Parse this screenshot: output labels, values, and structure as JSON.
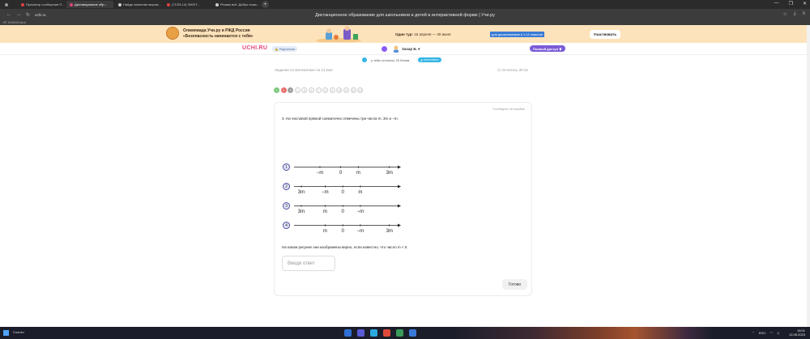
{
  "browser": {
    "tabs": [
      {
        "label": "",
        "color": "#9a9a9a"
      },
      {
        "label": "Просмотр сообщения П...",
        "color": "#e04040"
      },
      {
        "label": "Дистанционное обр...",
        "color": "#e0487a",
        "active": true
      },
      {
        "label": "Найди значение выраж...",
        "color": "#cfcfcf"
      },
      {
        "label": "(71/25-14) ФИЛ/Т...",
        "color": "#e04040"
      },
      {
        "label": "Решим всё: Добро пожа...",
        "color": "#cfcfcf"
      }
    ],
    "new_tab": "+",
    "window_controls": [
      "—",
      "❐",
      "✕"
    ],
    "url": "uchi.ru",
    "page_title": "Дистанционное образование для школьников и детей в интерактивной форме | Учи.ру",
    "bookmarks_text": "ИТ 19:30:04 Ахто"
  },
  "watermark": "РЕШИМ ВСЁ",
  "banner": {
    "olympiad_title": "Олимпиада Учи.ру и РЖД Россия",
    "olympiad_subtitle": "«Безопасность начинается с тебя»",
    "round_label": "Один тур:",
    "round_dates": "15 апреля — 30 июня",
    "highlight": "для дошкольников и 1-11 классов",
    "join_button": "Участвовать"
  },
  "header": {
    "logo": "UCHI.RU",
    "parents": "Родителям",
    "username": "Захар Б.",
    "premium": "Полный доступ"
  },
  "bonus": {
    "text": "у тебя осталось 20 бонов",
    "button": "пополнить"
  },
  "task": {
    "title": "Задание по математике на 13 мая",
    "time_left": "Осталось 30:16",
    "pages": [
      {
        "n": "1",
        "state": "done-green"
      },
      {
        "n": "2",
        "state": "done-red"
      },
      {
        "n": "3",
        "state": "current"
      },
      {
        "n": "4",
        "state": ""
      },
      {
        "n": "5",
        "state": ""
      },
      {
        "n": "6",
        "state": ""
      },
      {
        "n": "7",
        "state": ""
      },
      {
        "n": "8",
        "state": ""
      },
      {
        "n": "9",
        "state": ""
      },
      {
        "n": "10",
        "state": ""
      },
      {
        "n": "11",
        "state": ""
      },
      {
        "n": "12",
        "state": ""
      },
      {
        "n": "13",
        "state": ""
      }
    ],
    "report": "Сообщить об ошибке",
    "question": "3. На числовой прямой схематично отмечены три числа m, 3m и −m.",
    "number_lines": [
      {
        "n": "1",
        "labels": [
          {
            "t": "−m",
            "x": 0.25
          },
          {
            "t": "0",
            "x": 0.45
          },
          {
            "t": "m",
            "x": 0.62
          },
          {
            "t": "3m",
            "x": 0.92
          }
        ]
      },
      {
        "n": "2",
        "labels": [
          {
            "t": "3m",
            "x": 0.07
          },
          {
            "t": "−m",
            "x": 0.3
          },
          {
            "t": "0",
            "x": 0.47
          },
          {
            "t": "m",
            "x": 0.64
          }
        ]
      },
      {
        "n": "3",
        "labels": [
          {
            "t": "3m",
            "x": 0.07
          },
          {
            "t": "m",
            "x": 0.3
          },
          {
            "t": "0",
            "x": 0.47
          },
          {
            "t": "−m",
            "x": 0.64
          }
        ]
      },
      {
        "n": "4",
        "labels": [
          {
            "t": "m",
            "x": 0.3
          },
          {
            "t": "0",
            "x": 0.47
          },
          {
            "t": "−m",
            "x": 0.64
          },
          {
            "t": "3m",
            "x": 0.92
          }
        ]
      }
    ],
    "ask": "На каком рисунке они изображены верно, если известно, что число m < 0.",
    "input_placeholder": "Введи ответ",
    "ready_button": "Готово"
  },
  "taskbar": {
    "weather": "Солнеч",
    "lang": "ENG",
    "time": "16:01",
    "date": "12.05.2023"
  }
}
